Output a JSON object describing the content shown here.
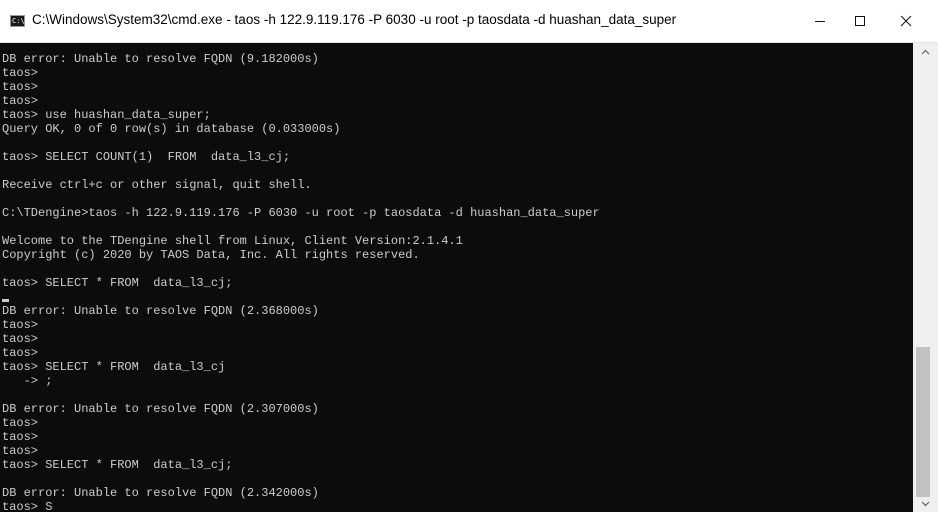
{
  "window": {
    "title": "C:\\Windows\\System32\\cmd.exe - taos  -h 122.9.119.176 -P 6030 -u root -p taosdata -d huashan_data_super",
    "icon_text": "C:\\.",
    "icon": "cmd-icon",
    "controls": {
      "minimize": "minimize-icon",
      "maximize": "maximize-icon",
      "close": "close-icon"
    }
  },
  "terminal": {
    "background": "#0c0c0c",
    "foreground": "#cccccc",
    "lines": [
      "DB error: Unable to resolve FQDN (9.182000s)",
      "taos>",
      "taos>",
      "taos>",
      "taos> use huashan_data_super;",
      "Query OK, 0 of 0 row(s) in database (0.033000s)",
      "",
      "taos> SELECT COUNT(1)  FROM  data_l3_cj;",
      "",
      "Receive ctrl+c or other signal, quit shell.",
      "",
      "C:\\TDengine>taos -h 122.9.119.176 -P 6030 -u root -p taosdata -d huashan_data_super",
      "",
      "Welcome to the TDengine shell from Linux, Client Version:2.1.4.1",
      "Copyright (c) 2020 by TAOS Data, Inc. All rights reserved.",
      "",
      "taos> SELECT * FROM  data_l3_cj;",
      "",
      "DB error: Unable to resolve FQDN (2.368000s)",
      "taos>",
      "taos>",
      "taos>",
      "taos> SELECT * FROM  data_l3_cj",
      "   -> ;",
      "",
      "DB error: Unable to resolve FQDN (2.307000s)",
      "taos>",
      "taos>",
      "taos>",
      "taos> SELECT * FROM  data_l3_cj;",
      "",
      "DB error: Unable to resolve FQDN (2.342000s)",
      "taos> S"
    ]
  },
  "scrollbar": {
    "up": "scroll-up-arrow-icon",
    "down": "scroll-down-arrow-icon",
    "thumb_position_fraction": 0.72
  }
}
